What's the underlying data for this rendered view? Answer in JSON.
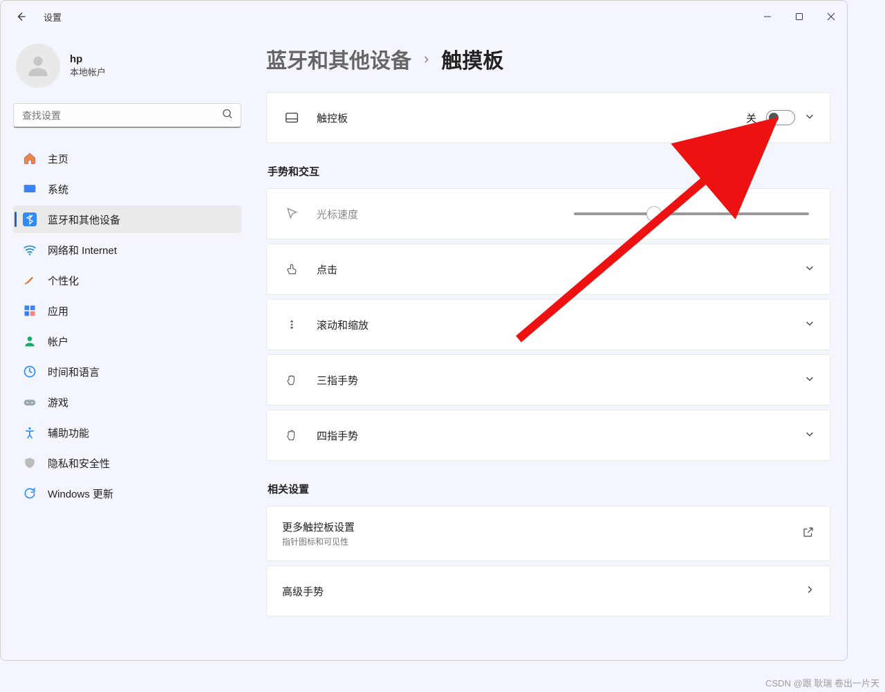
{
  "app": {
    "title": "设置"
  },
  "user": {
    "name": "hp",
    "account_type": "本地帐户"
  },
  "search": {
    "placeholder": "查找设置"
  },
  "nav": [
    {
      "key": "home",
      "label": "主页"
    },
    {
      "key": "system",
      "label": "系统"
    },
    {
      "key": "bluetooth",
      "label": "蓝牙和其他设备",
      "active": true
    },
    {
      "key": "network",
      "label": "网络和 Internet"
    },
    {
      "key": "personalization",
      "label": "个性化"
    },
    {
      "key": "apps",
      "label": "应用"
    },
    {
      "key": "accounts",
      "label": "帐户"
    },
    {
      "key": "time",
      "label": "时间和语言"
    },
    {
      "key": "gaming",
      "label": "游戏"
    },
    {
      "key": "accessibility",
      "label": "辅助功能"
    },
    {
      "key": "privacy",
      "label": "隐私和安全性"
    },
    {
      "key": "update",
      "label": "Windows 更新"
    }
  ],
  "breadcrumb": {
    "parent": "蓝牙和其他设备",
    "current": "触摸板"
  },
  "touchpad": {
    "label": "触控板",
    "state_label": "关"
  },
  "sections": {
    "gestures_title": "手势和交互",
    "cursor_speed": "光标速度",
    "tap": "点击",
    "scroll_zoom": "滚动和缩放",
    "three_finger": "三指手势",
    "four_finger": "四指手势",
    "related_title": "相关设置",
    "more_touchpad": {
      "title": "更多触控板设置",
      "sub": "指针图标和可见性"
    },
    "advanced_gestures": "高级手势"
  },
  "watermark": "CSDN @跟 耿瑞 卷出一片天"
}
